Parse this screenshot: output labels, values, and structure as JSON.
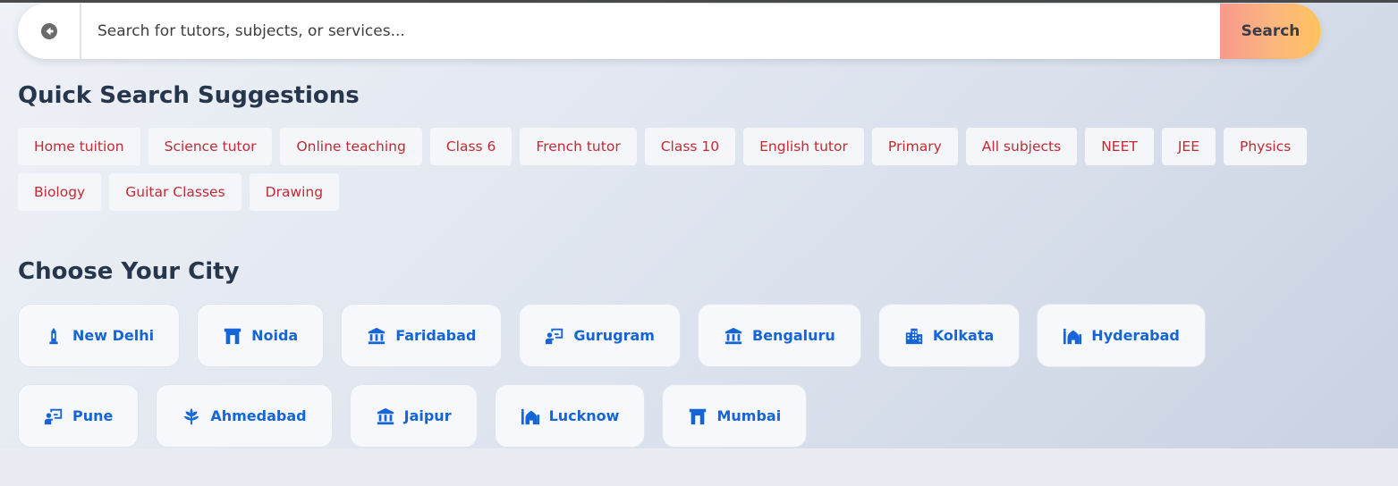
{
  "search": {
    "back_icon": "back-arrow-circle-icon",
    "placeholder": "Search for tutors, subjects, or services...",
    "button_label": "Search"
  },
  "quick_search": {
    "title": "Quick Search Suggestions",
    "tags": [
      "Home tuition",
      "Science tutor",
      "Online teaching",
      "Class 6",
      "French tutor",
      "Class 10",
      "English tutor",
      "Primary",
      "All subjects",
      "NEET",
      "JEE",
      "Physics",
      "Biology",
      "Guitar Classes",
      "Drawing"
    ]
  },
  "cities": {
    "title": "Choose Your City",
    "items": [
      {
        "label": "New Delhi",
        "icon": "monument-icon"
      },
      {
        "label": "Noida",
        "icon": "gate-icon"
      },
      {
        "label": "Faridabad",
        "icon": "institution-icon"
      },
      {
        "label": "Gurugram",
        "icon": "presentation-icon"
      },
      {
        "label": "Bengaluru",
        "icon": "institution-icon"
      },
      {
        "label": "Kolkata",
        "icon": "city-buildings-icon"
      },
      {
        "label": "Hyderabad",
        "icon": "mosque-icon"
      },
      {
        "label": "Pune",
        "icon": "presentation-icon"
      },
      {
        "label": "Ahmedabad",
        "icon": "plant-icon"
      },
      {
        "label": "Jaipur",
        "icon": "institution-icon"
      },
      {
        "label": "Lucknow",
        "icon": "mosque-icon"
      },
      {
        "label": "Mumbai",
        "icon": "gate-icon"
      }
    ]
  },
  "colors": {
    "accent_blue": "#1565d8",
    "tag_text": "#c42a34",
    "heading": "#26364d",
    "search_gradient": [
      "#f79a8e",
      "#fdc35e"
    ]
  }
}
